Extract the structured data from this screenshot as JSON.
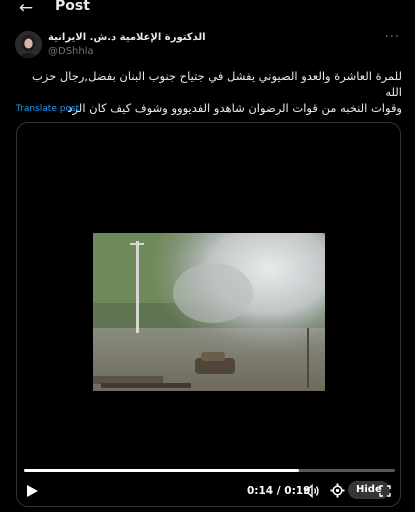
{
  "header": {
    "title": "Post",
    "back_icon": "arrow-left-icon"
  },
  "post": {
    "author_name": "الدكتورة الإعلامية د.ش. الايرانية",
    "author_handle": "@DShhla",
    "text_line1": "للمرة العاشرة  والعدو  الصيوني يفشل في جتياح جنوب  البنان بفضل,رجال حزب الله",
    "text_line2": "وقوات النخبه من قوات الرضوان  شاهدو الفديووو   وشوف كيف كان الرد",
    "translate_label": "Translate post",
    "more_icon": "more-options-icon"
  },
  "video": {
    "current_time": "0:14",
    "separator": "/",
    "duration": "0:19",
    "progress": 0.74,
    "hide_label": "Hide"
  }
}
